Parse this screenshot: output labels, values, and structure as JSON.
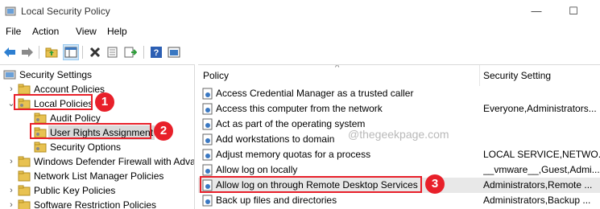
{
  "window": {
    "title": "Local Security Policy",
    "minimize": "—",
    "maximize": "☐"
  },
  "menu": [
    "File",
    "Action",
    "View",
    "Help"
  ],
  "toolbar": {
    "icons": [
      "back-arrow-icon",
      "forward-arrow-icon",
      "up-folder-icon",
      "show-hide-tree-icon",
      "delete-icon",
      "properties-icon",
      "export-list-icon",
      "help-icon",
      "console-icon"
    ]
  },
  "tree": {
    "root": "Security Settings",
    "items": [
      {
        "label": "Account Policies",
        "expanded": false
      },
      {
        "label": "Local Policies",
        "expanded": true
      },
      {
        "label": "Audit Policy"
      },
      {
        "label": "User Rights Assignment",
        "selected": true
      },
      {
        "label": "Security Options"
      },
      {
        "label": "Windows Defender Firewall with Adva"
      },
      {
        "label": "Network List Manager Policies"
      },
      {
        "label": "Public Key Policies"
      },
      {
        "label": "Software Restriction Policies"
      }
    ]
  },
  "list": {
    "columns": [
      "Policy",
      "Security Setting"
    ],
    "rows": [
      {
        "policy": "Access Credential Manager as a trusted caller",
        "setting": ""
      },
      {
        "policy": "Access this computer from the network",
        "setting": "Everyone,Administrators..."
      },
      {
        "policy": "Act as part of the operating system",
        "setting": ""
      },
      {
        "policy": "Add workstations to domain",
        "setting": ""
      },
      {
        "policy": "Adjust memory quotas for a process",
        "setting": "LOCAL SERVICE,NETWO..."
      },
      {
        "policy": "Allow log on locally",
        "setting": "__vmware__,Guest,Admi..."
      },
      {
        "policy": "Allow log on through Remote Desktop Services",
        "setting": "Administrators,Remote ..."
      },
      {
        "policy": "Back up files and directories",
        "setting": "Administrators,Backup ..."
      }
    ]
  },
  "annotations": {
    "b1": "1",
    "b2": "2",
    "b3": "3",
    "color": "#e8202a"
  },
  "watermark": "@thegeekpage.com"
}
